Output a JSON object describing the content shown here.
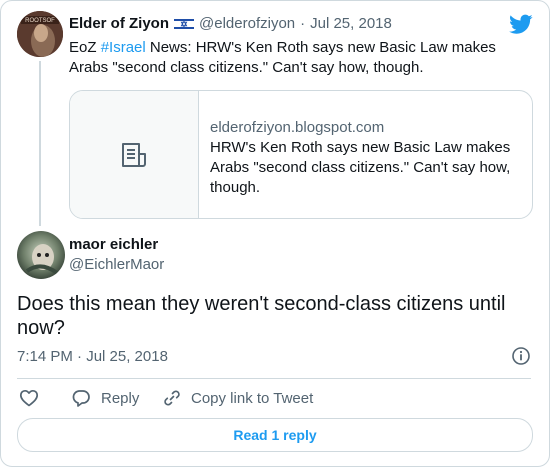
{
  "parent_tweet": {
    "author_name": "Elder of Ziyon",
    "handle": "@elderofziyon",
    "separator": "·",
    "date": "Jul 25, 2018",
    "text_prefix": "EoZ ",
    "hashtag": "#Israel",
    "text_rest": " News: HRW's Ken Roth says new Basic Law makes Arabs \"second class citizens.\" Can't say how, though.",
    "avatar_text": "ROOTSOF",
    "flag_icon": "israel-flag-icon"
  },
  "link_preview": {
    "domain": "elderofziyon.blogspot.com",
    "title": "HRW's Ken Roth says new Basic Law makes Arabs \"second class citizens.\" Can't say how, though.",
    "icon": "document-icon"
  },
  "main_tweet": {
    "author_name": "maor eichler",
    "handle": "@EichlerMaor",
    "text": "Does this mean they weren't second-class citizens until now?",
    "timestamp": "7:14 PM · Jul 25, 2018"
  },
  "actions": {
    "reply_label": "Reply",
    "copy_label": "Copy link to Tweet"
  },
  "read_replies_label": "Read 1 reply",
  "colors": {
    "accent": "#1d9bf0",
    "muted": "#536471",
    "border": "#cfd9de"
  }
}
